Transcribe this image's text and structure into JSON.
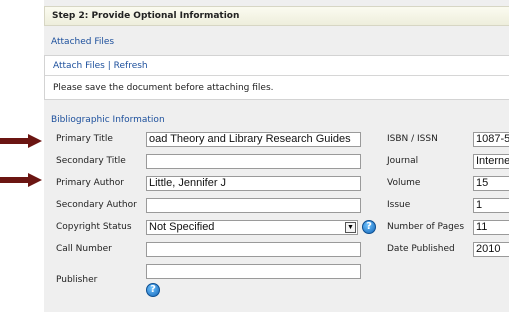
{
  "step_header": "Step 2: Provide Optional Information",
  "attached_files": {
    "title": "Attached Files",
    "attach_link": "Attach Files",
    "separator": "|",
    "refresh_link": "Refresh",
    "notice": "Please save the document before attaching files."
  },
  "biblio": {
    "title": "Bibliographic Information",
    "primary_title": {
      "label": "Primary Title",
      "value": "oad Theory and Library Research Guides"
    },
    "secondary_title": {
      "label": "Secondary Title",
      "value": ""
    },
    "primary_author": {
      "label": "Primary Author",
      "value": "Little, Jennifer J"
    },
    "secondary_author": {
      "label": "Secondary Author",
      "value": ""
    },
    "copyright_status": {
      "label": "Copyright Status",
      "value": "Not Specified"
    },
    "call_number": {
      "label": "Call Number",
      "value": ""
    },
    "publisher": {
      "label": "Publisher",
      "value": ""
    },
    "isbn": {
      "label": "ISBN / ISSN",
      "value": "1087-5"
    },
    "journal": {
      "label": "Journal",
      "value": "Interne"
    },
    "volume": {
      "label": "Volume",
      "value": "15"
    },
    "issue": {
      "label": "Issue",
      "value": "1"
    },
    "pages": {
      "label": "Number of Pages",
      "value": "11"
    },
    "date_published": {
      "label": "Date Published",
      "value": "2010"
    }
  },
  "icons": {
    "help": "?",
    "dropdown": "▼",
    "arrow": "right-arrow-icon"
  },
  "colors": {
    "link": "#1c4f9c",
    "arrow": "#6b1512",
    "help": "#1466b8"
  }
}
